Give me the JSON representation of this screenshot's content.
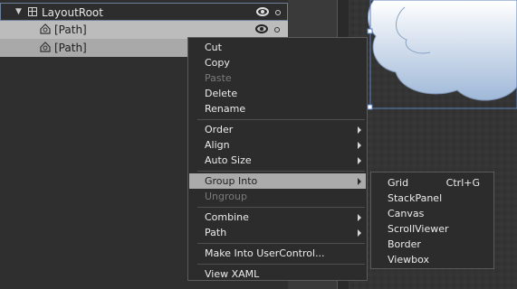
{
  "objects_tree": {
    "root": {
      "label": "LayoutRoot"
    },
    "children": [
      {
        "label": "[Path]"
      },
      {
        "label": "[Path]"
      }
    ]
  },
  "context_menu": {
    "items": {
      "cut": "Cut",
      "copy": "Copy",
      "paste": "Paste",
      "delete": "Delete",
      "rename": "Rename",
      "order": "Order",
      "align": "Align",
      "auto_size": "Auto Size",
      "group_into": "Group Into",
      "ungroup": "Ungroup",
      "combine": "Combine",
      "path": "Path",
      "make_into_usercontrol": "Make Into UserControl...",
      "view_xaml": "View XAML"
    }
  },
  "group_into_submenu": {
    "grid": "Grid",
    "grid_shortcut": "Ctrl+G",
    "stackpanel": "StackPanel",
    "canvas": "Canvas",
    "scrollviewer": "ScrollViewer",
    "border": "Border",
    "viewbox": "Viewbox"
  },
  "colors": {
    "highlight": "#ababab",
    "selection_border": "#6d7f9a",
    "cloud_fill_top": "#ffffff",
    "cloud_fill_bottom": "#9fb8d8"
  },
  "icons": {
    "expander": "triangle-down-icon",
    "root": "grid-icon",
    "path": "path-icon",
    "visibility": "eye-icon",
    "lock": "lock-circle-icon",
    "submenu": "chevron-right-icon"
  }
}
